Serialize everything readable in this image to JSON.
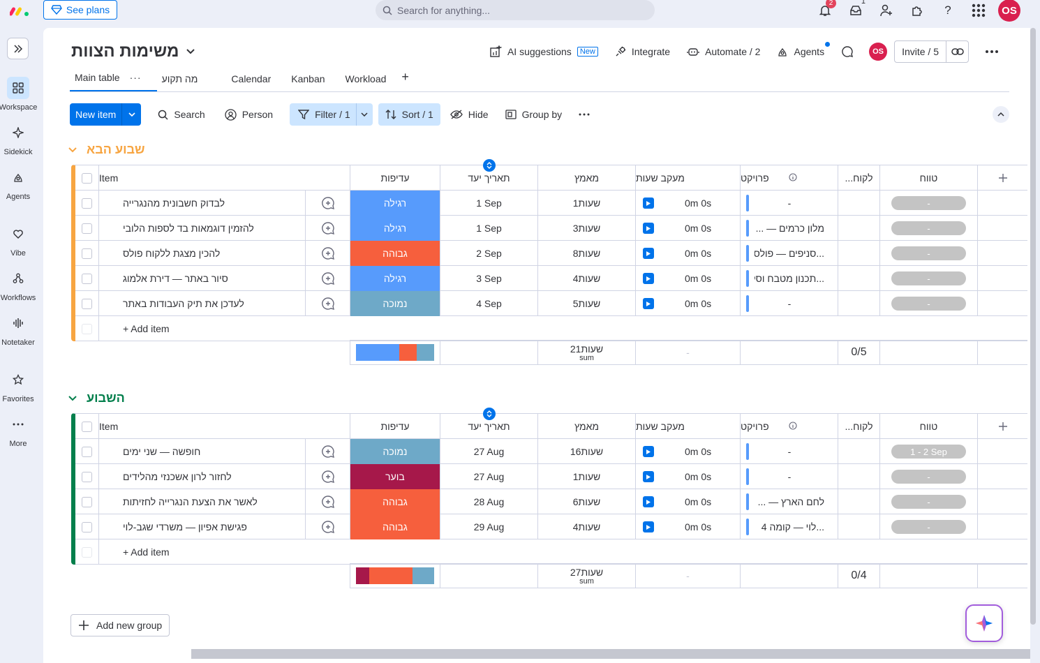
{
  "topbar": {
    "see_plans": "See plans",
    "search_placeholder": "Search for anything...",
    "notifications_count": "2",
    "inbox_count": "1",
    "avatar_initials": "OS"
  },
  "leftnav": {
    "items": [
      {
        "label": "Workspace",
        "icon": "grid-icon"
      },
      {
        "label": "Sidekick",
        "icon": "sparkle-icon"
      },
      {
        "label": "Agents",
        "icon": "agents-icon"
      },
      {
        "label": "Vibe",
        "icon": "heart-icon"
      },
      {
        "label": "Workflows",
        "icon": "workflows-icon"
      },
      {
        "label": "Notetaker",
        "icon": "soundwave-icon"
      },
      {
        "label": "Favorites",
        "icon": "star-icon"
      },
      {
        "label": "More",
        "icon": "dots-icon"
      }
    ]
  },
  "board": {
    "title": "משימות הצוות",
    "ai_suggestions": "AI suggestions",
    "new_tag": "New",
    "integrate": "Integrate",
    "automate": "Automate / 2",
    "agents": "Agents",
    "avatar_initials": "OS",
    "invite": "Invite / 5"
  },
  "tabs": [
    "Main table",
    "מה תקוע",
    "Calendar",
    "Kanban",
    "Workload"
  ],
  "toolbar": {
    "new_item": "New item",
    "search": "Search",
    "person": "Person",
    "filter": "Filter / 1",
    "sort": "Sort / 1",
    "hide": "Hide",
    "group_by": "Group by"
  },
  "columns": {
    "item": "Item",
    "priority": "עדיפות",
    "due_date": "תאריך יעד",
    "effort": "מאמץ",
    "time_tracking": "מעקב שעות",
    "project": "פרויקט",
    "client": "...לקוח",
    "timeline": "טווח"
  },
  "colors": {
    "regular": "#579bfc",
    "high": "#f65f3d",
    "low": "#6ea9c8",
    "urgent": "#a6184a",
    "group1": "#f7a541",
    "group2": "#037f4c"
  },
  "groups": [
    {
      "title": "שבוע הבא",
      "color": "#f7a541",
      "rows": [
        {
          "item": "לבדוק חשבונית מהנגרייה",
          "priority": "רגילה",
          "prio_color": "#579bfc",
          "date": "1 Sep",
          "effort": "1שעות",
          "time": "0m 0s",
          "project": "-",
          "timeline": "-"
        },
        {
          "item": "להזמין דוגמאות בד לספות הלובי",
          "priority": "רגילה",
          "prio_color": "#579bfc",
          "date": "1 Sep",
          "effort": "3שעות",
          "time": "0m 0s",
          "project": "מלון כרמים — ...",
          "timeline": "-"
        },
        {
          "item": "להכין מצגת ללקוח פולס",
          "priority": "גבוהה",
          "prio_color": "#f65f3d",
          "date": "2 Sep",
          "effort": "8שעות",
          "time": "0m 0s",
          "project": "...סניפים — פולס",
          "timeline": "-"
        },
        {
          "item": "סיור באתר — דירת אלמוג",
          "priority": "רגילה",
          "prio_color": "#579bfc",
          "date": "3 Sep",
          "effort": "4שעות",
          "time": "0m 0s",
          "project": "...תכנון מטבח וסלון",
          "timeline": "-"
        },
        {
          "item": "לעדכן את תיק העבודות באתר",
          "priority": "נמוכה",
          "prio_color": "#6ea9c8",
          "date": "4 Sep",
          "effort": "5שעות",
          "time": "0m 0s",
          "project": "-",
          "timeline": "-"
        }
      ],
      "add_item": "+ Add item",
      "summary": {
        "effort": "21שעות",
        "effort_label": "sum",
        "time": "-",
        "client": "0/5"
      },
      "prio_dist": [
        {
          "color": "#579bfc",
          "share": 0.55
        },
        {
          "color": "#f65f3d",
          "share": 0.22
        },
        {
          "color": "#6ea9c8",
          "share": 0.23
        }
      ]
    },
    {
      "title": "השבוע",
      "color": "#037f4c",
      "rows": [
        {
          "item": "חופשה — שני ימים",
          "priority": "נמוכה",
          "prio_color": "#6ea9c8",
          "date": "27 Aug",
          "effort": "16שעות",
          "time": "0m 0s",
          "project": "-",
          "timeline": "1 - 2 Sep"
        },
        {
          "item": "לחזור לרון אשכנזי מהלידים",
          "priority": "בוער",
          "prio_color": "#a6184a",
          "date": "27 Aug",
          "effort": "1שעות",
          "time": "0m 0s",
          "project": "-",
          "timeline": "-"
        },
        {
          "item": "לאשר את הצעת הנגרייה לחזיתות",
          "priority": "גבוהה",
          "prio_color": "#f65f3d",
          "date": "28 Aug",
          "effort": "6שעות",
          "time": "0m 0s",
          "project": "לחם הארץ — ...",
          "timeline": "-"
        },
        {
          "item": "פגישת אפיון — משרדי שגב-לוי",
          "priority": "גבוהה",
          "prio_color": "#f65f3d",
          "date": "29 Aug",
          "effort": "4שעות",
          "time": "0m 0s",
          "project": "...לוי — קומה 4",
          "timeline": "-"
        }
      ],
      "add_item": "+ Add item",
      "summary": {
        "effort": "27שעות",
        "effort_label": "sum",
        "time": "-",
        "client": "0/4"
      },
      "prio_dist": [
        {
          "color": "#a6184a",
          "share": 0.17
        },
        {
          "color": "#f65f3d",
          "share": 0.55
        },
        {
          "color": "#6ea9c8",
          "share": 0.28
        }
      ]
    }
  ],
  "add_new_group": "Add new group"
}
